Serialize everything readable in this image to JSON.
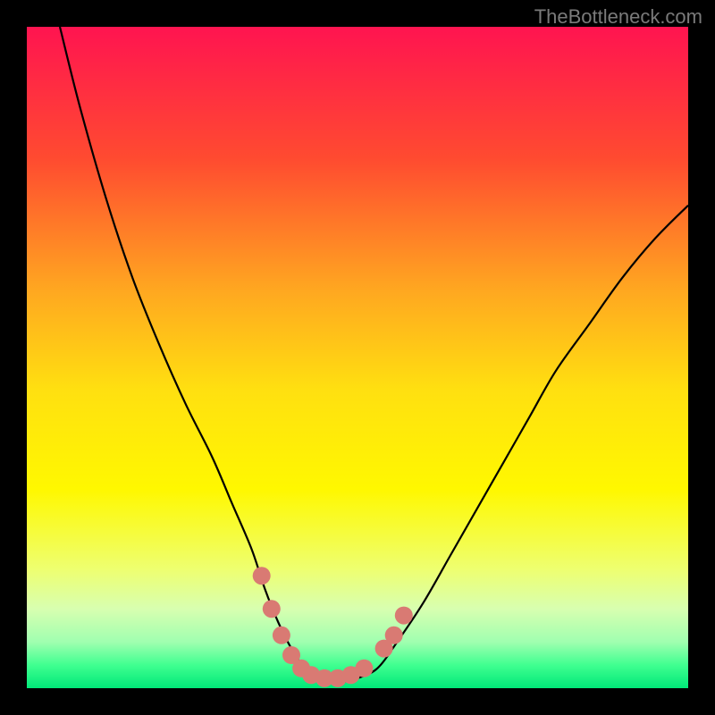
{
  "watermark": "TheBottleneck.com",
  "chart_data": {
    "type": "line",
    "title": "",
    "xlabel": "",
    "ylabel": "",
    "xlim": [
      0,
      100
    ],
    "ylim": [
      0,
      100
    ],
    "gradient_stops": [
      {
        "offset": 0.0,
        "color": "#ff1450"
      },
      {
        "offset": 0.2,
        "color": "#ff4b30"
      },
      {
        "offset": 0.4,
        "color": "#ffa820"
      },
      {
        "offset": 0.55,
        "color": "#ffe010"
      },
      {
        "offset": 0.7,
        "color": "#fff800"
      },
      {
        "offset": 0.82,
        "color": "#eeff70"
      },
      {
        "offset": 0.88,
        "color": "#d8ffb0"
      },
      {
        "offset": 0.93,
        "color": "#a0ffb0"
      },
      {
        "offset": 0.965,
        "color": "#40ff90"
      },
      {
        "offset": 1.0,
        "color": "#00e878"
      }
    ],
    "series": [
      {
        "name": "bottleneck-curve",
        "x": [
          5,
          8,
          12,
          16,
          20,
          24,
          28,
          31,
          34,
          36,
          38,
          40,
          42,
          44,
          46,
          48,
          50,
          53,
          56,
          60,
          64,
          68,
          72,
          76,
          80,
          85,
          90,
          95,
          100
        ],
        "y": [
          100,
          88,
          74,
          62,
          52,
          43,
          35,
          28,
          21,
          15,
          10,
          6,
          3,
          1.5,
          1,
          1,
          1.5,
          3,
          7,
          13,
          20,
          27,
          34,
          41,
          48,
          55,
          62,
          68,
          73
        ]
      }
    ],
    "highlight_points": {
      "name": "salmon-dots",
      "color": "#d97a73",
      "points": [
        {
          "x": 35.5,
          "y": 17
        },
        {
          "x": 37,
          "y": 12
        },
        {
          "x": 38.5,
          "y": 8
        },
        {
          "x": 40,
          "y": 5
        },
        {
          "x": 41.5,
          "y": 3
        },
        {
          "x": 43,
          "y": 2
        },
        {
          "x": 45,
          "y": 1.5
        },
        {
          "x": 47,
          "y": 1.5
        },
        {
          "x": 49,
          "y": 2
        },
        {
          "x": 51,
          "y": 3
        },
        {
          "x": 54,
          "y": 6
        },
        {
          "x": 55.5,
          "y": 8
        },
        {
          "x": 57,
          "y": 11
        }
      ]
    }
  }
}
